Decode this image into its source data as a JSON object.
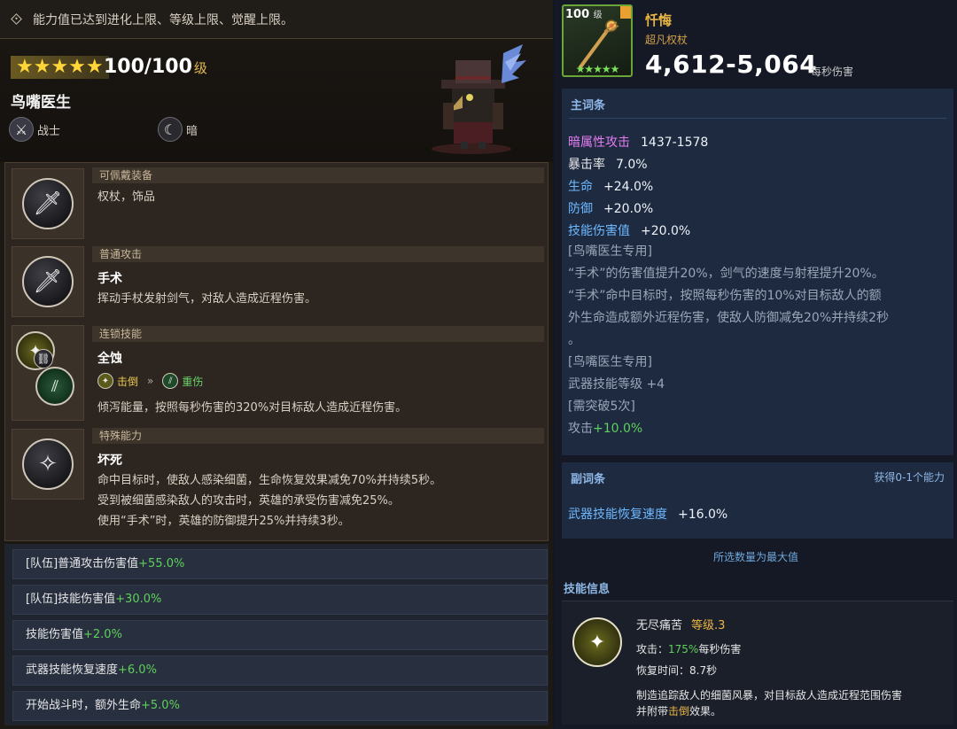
{
  "notice": "能力值已达到进化上限、等级上限、觉醒上限。",
  "hero": {
    "stars": "★★★★★",
    "level": "100/100",
    "level_unit": "级",
    "name": "鸟嘴医生",
    "class": "战士",
    "element": "暗"
  },
  "abilities": {
    "equip": {
      "title": "可佩戴装备",
      "text": "权杖，饰品"
    },
    "normal": {
      "title": "普通攻击",
      "name": "手术",
      "text": "挥动手杖发射剑气，对敌人造成近程伤害。"
    },
    "chain": {
      "title": "连锁技能",
      "name": "全蚀",
      "from": "击倒",
      "arrow": "»",
      "to": "重伤",
      "text": "倾泻能量，按照每秒伤害的320%对目标敌人造成近程伤害。"
    },
    "special": {
      "title": "特殊能力",
      "name": "坏死",
      "lines": [
        "命中目标时，使敌人感染细菌，生命恢复效果减免70%并持续5秒。",
        "受到被细菌感染敌人的攻击时，英雄的承受伤害减免25%。",
        "使用“手术”时，英雄的防御提升25%并持续3秒。"
      ]
    }
  },
  "bonuses": [
    {
      "label": "[队伍]普通攻击伤害值",
      "value": "+55.0%"
    },
    {
      "label": "[队伍]技能伤害值",
      "value": "+30.0%"
    },
    {
      "label": "技能伤害值",
      "value": "+2.0%"
    },
    {
      "label": "武器技能恢复速度",
      "value": "+6.0%"
    },
    {
      "label": "开始战斗时，额外生命",
      "value": "+5.0%"
    }
  ],
  "weapon": {
    "level": "100",
    "level_unit": "级",
    "stars": "★★★★★",
    "name": "忏悔",
    "type": "超凡权杖",
    "dps": "4,612-5,064",
    "dps_unit": "每秒伤害"
  },
  "main_options": {
    "header": "主词条",
    "stats": [
      {
        "key": "暗属性攻击",
        "value": "1437-1578"
      },
      {
        "key": "暴击率",
        "value": "7.0%"
      },
      {
        "key": "生命",
        "value": "+24.0%"
      },
      {
        "key": "防御",
        "value": "+20.0%"
      },
      {
        "key": "技能伤害值",
        "value": "+20.0%"
      }
    ],
    "desc_lines": [
      "[鸟嘴医生专用]",
      "“手术”的伤害值提升20%，剑气的速度与射程提升20%。",
      "“手术”命中目标时，按照每秒伤害的10%对目标敌人的额",
      "外生命造成额外近程伤害，使敌人防御减免20%并持续2秒",
      "。",
      "[鸟嘴医生专用]",
      "武器技能等级 +4",
      "[需突破5次]"
    ],
    "attack_label": "攻击",
    "attack_value": "+10.0%"
  },
  "sub_options": {
    "header": "副词条",
    "right": "获得0-1个能力",
    "stat_key": "武器技能恢复速度",
    "stat_value": "+16.0%"
  },
  "max_note": "所选数量为最大值",
  "skill_info": {
    "header": "技能信息",
    "name": "无尽痛苦",
    "level": "等级.3",
    "attack_label": "攻击：",
    "attack_pct": "175%",
    "attack_suffix": "每秒伤害",
    "cooldown": "恢复时间：8.7秒",
    "desc1": "制造追踪敌人的细菌风暴，对目标敌人造成近程范围伤害",
    "desc2_pre": "并附带",
    "desc2_highlight": "击倒",
    "desc2_post": "效果。"
  },
  "colors": {
    "green": "#5fd05a",
    "gold": "#e9b644",
    "blue_key": "#6fb9ff",
    "dark_element": "#e57cf0"
  },
  "icons": [
    "warrior-icon",
    "dark-moon-icon",
    "equip-icon",
    "sword-icon",
    "chain-icon",
    "sparkle-icon",
    "staff-icon",
    "skill-icon"
  ]
}
